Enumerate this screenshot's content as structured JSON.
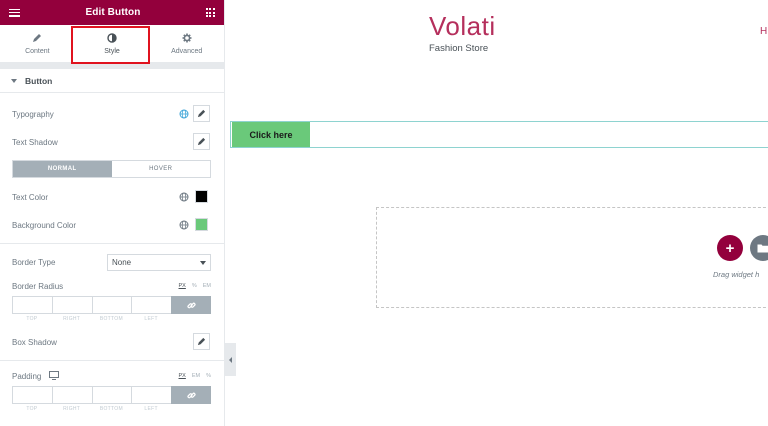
{
  "panel": {
    "title": "Edit Button",
    "tabs": [
      {
        "label": "Content",
        "icon": "pencil-icon"
      },
      {
        "label": "Style",
        "icon": "half-circle-icon",
        "active": true
      },
      {
        "label": "Advanced",
        "icon": "gear-icon"
      }
    ],
    "section": "Button",
    "controls": {
      "typography": "Typography",
      "text_shadow": "Text Shadow",
      "state_normal": "NORMAL",
      "state_hover": "HOVER",
      "text_color": "Text Color",
      "text_color_value": "#000000",
      "background_color": "Background Color",
      "background_color_value": "#6ac97a",
      "border_type": "Border Type",
      "border_type_value": "None",
      "border_radius": "Border Radius",
      "box_shadow": "Box Shadow",
      "padding": "Padding",
      "units_a": [
        "PX",
        "%",
        "EM"
      ],
      "units_b": [
        "PX",
        "EM",
        "%"
      ],
      "dimension_labels": [
        "TOP",
        "RIGHT",
        "BOTTOM",
        "LEFT"
      ]
    }
  },
  "canvas": {
    "site_title": "Volati",
    "site_tagline": "Fashion Store",
    "nav_peek": "H",
    "button_text": "Click here",
    "drag_text": "Drag widget h"
  },
  "colors": {
    "brand": "#93003c",
    "accent": "#b52f5c",
    "button_bg": "#6ac97a"
  }
}
